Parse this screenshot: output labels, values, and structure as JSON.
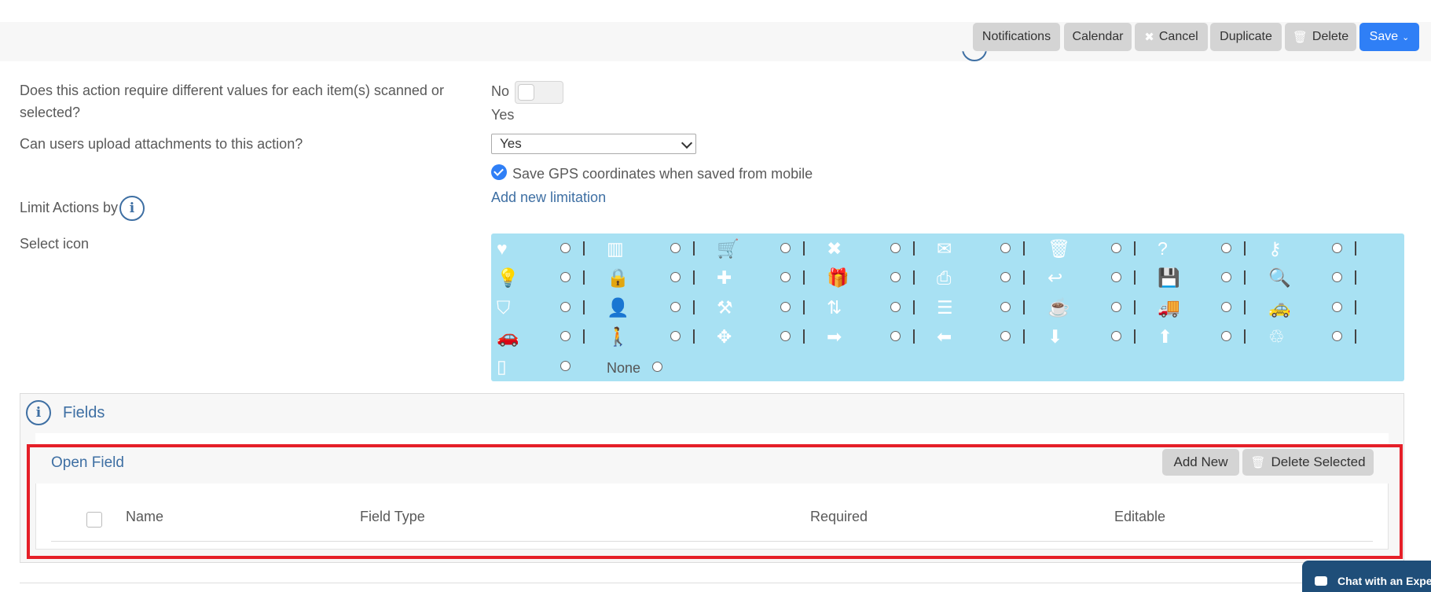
{
  "toolbar": {
    "notifications": "Notifications",
    "calendar": "Calendar",
    "cancel": "Cancel",
    "duplicate": "Duplicate",
    "delete": "Delete",
    "save": "Save"
  },
  "form": {
    "different_values_question_line1": "Does this action require different values for each item(s) scanned or",
    "different_values_question_line2": "selected?",
    "toggle_off_label": "No",
    "toggle_on_label": "Yes",
    "attachments_question": "Can users upload attachments to this action?",
    "attachments_value": "Yes",
    "gps_label": "Save GPS coordinates when saved from mobile",
    "limit_label": "Limit Actions by",
    "add_limitation_link": "Add new limitation",
    "select_icon_label": "Select icon",
    "icon_none_label": "None"
  },
  "icons": [
    {
      "name": "heart-icon",
      "glyph": "♥"
    },
    {
      "name": "barcode-icon",
      "glyph": "▥"
    },
    {
      "name": "cart-icon",
      "glyph": "🛒"
    },
    {
      "name": "x-icon",
      "glyph": "✖"
    },
    {
      "name": "envelope-icon",
      "glyph": "✉"
    },
    {
      "name": "trash-icon",
      "glyph": "🗑"
    },
    {
      "name": "question-icon",
      "glyph": "?"
    },
    {
      "name": "key-icon",
      "glyph": "⚷"
    },
    {
      "name": "lightbulb-icon",
      "glyph": "💡"
    },
    {
      "name": "lock-icon",
      "glyph": "🔒"
    },
    {
      "name": "plus-icon",
      "glyph": "✚"
    },
    {
      "name": "gift-icon",
      "glyph": "🎁"
    },
    {
      "name": "printer-icon",
      "glyph": "⎙"
    },
    {
      "name": "return-icon",
      "glyph": "↩"
    },
    {
      "name": "floppy-disk-icon",
      "glyph": "💾"
    },
    {
      "name": "magnifier-icon",
      "glyph": "🔍"
    },
    {
      "name": "shield-icon",
      "glyph": "⛉"
    },
    {
      "name": "user-icon",
      "glyph": "👤"
    },
    {
      "name": "tools-icon",
      "glyph": "⚒"
    },
    {
      "name": "sort-arrows-icon",
      "glyph": "⇅"
    },
    {
      "name": "layers-icon",
      "glyph": "☰"
    },
    {
      "name": "coffee-cup-icon",
      "glyph": "☕"
    },
    {
      "name": "truck-icon",
      "glyph": "🚚"
    },
    {
      "name": "taxi-icon",
      "glyph": "🚕"
    },
    {
      "name": "car-icon",
      "glyph": "🚗"
    },
    {
      "name": "person-icon",
      "glyph": "🚶"
    },
    {
      "name": "move-icon",
      "glyph": "✥"
    },
    {
      "name": "arrow-right-icon",
      "glyph": "➡"
    },
    {
      "name": "arrow-left-icon",
      "glyph": "⬅"
    },
    {
      "name": "arrow-down-icon",
      "glyph": "⬇"
    },
    {
      "name": "arrow-up-icon",
      "glyph": "⬆"
    },
    {
      "name": "trash-can-icon",
      "glyph": "♲"
    },
    {
      "name": "tablet-icon",
      "glyph": "▯"
    }
  ],
  "fields": {
    "title": "Fields",
    "open_field": {
      "title": "Open Field",
      "add_new": "Add New",
      "delete_selected": "Delete Selected",
      "columns": [
        "Name",
        "Field Type",
        "Required",
        "Editable"
      ]
    }
  },
  "chat": {
    "label": "Chat with an Expert"
  },
  "colors": {
    "accent": "#2f7ff6",
    "link": "#3e6fa3",
    "icon_panel": "#a8e1f3",
    "highlight": "#e51f28"
  }
}
